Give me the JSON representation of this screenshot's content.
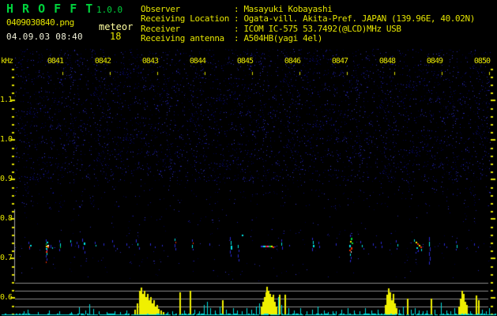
{
  "app": {
    "title": "H R O F F T",
    "version": "1.0.0"
  },
  "session": {
    "filename": "0409030840.png",
    "mode": "meteor",
    "datetime": "04.09.03 08:40",
    "echo_count": "18"
  },
  "station": {
    "rows": [
      {
        "label": "Observer",
        "value": "Masayuki Kobayashi"
      },
      {
        "label": "Receiving Location",
        "value": "Ogata-vill. Akita-Pref. JAPAN (139.96E, 40.02N)"
      },
      {
        "label": "Receiver",
        "value": "ICOM IC-575 53.7492(@LCD)MHz USB"
      },
      {
        "label": "Receiving antenna",
        "value": "A504HB(yagi 4el)"
      }
    ]
  },
  "colors": {
    "accent_green": "#00d23c",
    "accent_yellow": "#e3e300",
    "pale_yellow": "#ffffa0",
    "white_text": "#f0f0d8",
    "grid_gray": "#8a8a8a",
    "scale_bar_gray": "#a0a0a0",
    "trace_cyan": "#00e0e0",
    "trace_yellow": "#f0f000",
    "noise_blues": [
      "#00003e",
      "#000060",
      "#0e0e7a",
      "#1a1a92",
      "#2626ae",
      "#3434c8"
    ],
    "echo_palette": {
      "b": "#2a2ad2",
      "c": "#00e8e8",
      "g": "#00d838",
      "r": "#f03000",
      "m": "#e030d0",
      "y": "#f0f000",
      "w": "#f8f8f8"
    }
  },
  "chart_data": {
    "type": "heatmap",
    "ylabel": "kHz",
    "x_tick_labels": [
      "0841",
      "0842",
      "0843",
      "0844",
      "0845",
      "0846",
      "0847",
      "0848",
      "0849",
      "0850"
    ],
    "y_tick_labels": [
      "1.1",
      "1.0",
      "0.9",
      "0.8",
      "0.7",
      "0.6"
    ],
    "y_range_khz": [
      0.56,
      1.18
    ],
    "x_range_minutes": [
      0,
      10
    ],
    "echo_band_khz": 0.73,
    "echoes": [
      [
        0.28,
        0.742,
        1,
        3,
        "b"
      ],
      [
        0.32,
        0.734,
        2,
        2,
        "c"
      ],
      [
        0.3,
        0.73,
        1,
        2,
        "r"
      ],
      [
        0.3,
        0.726,
        1,
        2,
        "b"
      ],
      [
        0.65,
        0.748,
        1,
        3,
        "b"
      ],
      [
        0.67,
        0.742,
        2,
        2,
        "c"
      ],
      [
        0.65,
        0.738,
        1,
        2,
        "g"
      ],
      [
        0.68,
        0.734,
        2,
        2,
        "w"
      ],
      [
        0.65,
        0.732,
        2,
        2,
        "y"
      ],
      [
        0.68,
        0.73,
        2,
        2,
        "r"
      ],
      [
        0.65,
        0.726,
        2,
        2,
        "c"
      ],
      [
        0.67,
        0.722,
        1,
        2,
        "m"
      ],
      [
        0.65,
        0.718,
        2,
        2,
        "r"
      ],
      [
        0.67,
        0.714,
        1,
        3,
        "c"
      ],
      [
        0.65,
        0.708,
        1,
        3,
        "b"
      ],
      [
        0.67,
        0.7,
        1,
        3,
        "b"
      ],
      [
        0.65,
        0.692,
        1,
        2,
        "r"
      ],
      [
        0.75,
        0.734,
        1,
        4,
        "b"
      ],
      [
        0.78,
        0.728,
        1,
        2,
        "c"
      ],
      [
        0.93,
        0.746,
        1,
        3,
        "b"
      ],
      [
        0.95,
        0.738,
        1,
        4,
        "c"
      ],
      [
        0.95,
        0.73,
        1,
        2,
        "g"
      ],
      [
        0.93,
        0.724,
        1,
        3,
        "b"
      ],
      [
        1.17,
        0.746,
        1,
        3,
        "c"
      ],
      [
        1.18,
        0.738,
        1,
        4,
        "b"
      ],
      [
        1.3,
        0.742,
        1,
        3,
        "b"
      ],
      [
        1.33,
        0.734,
        1,
        4,
        "b"
      ],
      [
        1.42,
        0.75,
        1,
        4,
        "b"
      ],
      [
        1.45,
        0.74,
        2,
        3,
        "c"
      ],
      [
        1.43,
        0.73,
        1,
        4,
        "b"
      ],
      [
        1.47,
        0.718,
        1,
        3,
        "b"
      ],
      [
        1.68,
        0.742,
        1,
        3,
        "b"
      ],
      [
        1.7,
        0.734,
        1,
        2,
        "c"
      ],
      [
        1.87,
        0.738,
        1,
        3,
        "b"
      ],
      [
        2.05,
        0.746,
        1,
        3,
        "b"
      ],
      [
        2.08,
        0.734,
        1,
        3,
        "b"
      ],
      [
        2.15,
        0.726,
        1,
        2,
        "b"
      ],
      [
        2.35,
        0.738,
        1,
        3,
        "b"
      ],
      [
        2.4,
        0.73,
        1,
        2,
        "b"
      ],
      [
        2.55,
        0.748,
        1,
        4,
        "b"
      ],
      [
        2.58,
        0.738,
        1,
        3,
        "c"
      ],
      [
        2.62,
        0.728,
        1,
        3,
        "b"
      ],
      [
        2.85,
        0.738,
        1,
        3,
        "b"
      ],
      [
        2.95,
        0.73,
        1,
        2,
        "b"
      ],
      [
        3.1,
        0.734,
        1,
        2,
        "b"
      ],
      [
        3.37,
        0.75,
        1,
        3,
        "c"
      ],
      [
        3.38,
        0.742,
        1,
        2,
        "r"
      ],
      [
        3.37,
        0.736,
        1,
        4,
        "b"
      ],
      [
        3.38,
        0.726,
        1,
        3,
        "b"
      ],
      [
        3.73,
        0.748,
        1,
        3,
        "b"
      ],
      [
        3.75,
        0.74,
        1,
        2,
        "r"
      ],
      [
        3.73,
        0.734,
        1,
        4,
        "c"
      ],
      [
        3.75,
        0.724,
        1,
        2,
        "b"
      ],
      [
        4.1,
        0.738,
        1,
        3,
        "b"
      ],
      [
        4.53,
        0.754,
        1,
        4,
        "b"
      ],
      [
        4.55,
        0.744,
        1,
        5,
        "c"
      ],
      [
        4.55,
        0.732,
        2,
        5,
        "c"
      ],
      [
        4.53,
        0.72,
        1,
        4,
        "b"
      ],
      [
        4.55,
        0.71,
        1,
        3,
        "b"
      ],
      [
        4.7,
        0.734,
        1,
        4,
        "c"
      ],
      [
        4.72,
        0.722,
        1,
        3,
        "b"
      ],
      [
        4.7,
        0.71,
        1,
        4,
        "b"
      ],
      [
        4.72,
        0.698,
        1,
        3,
        "b"
      ],
      [
        4.78,
        0.76,
        2,
        2,
        "c"
      ],
      [
        5.18,
        0.732,
        3,
        2,
        "b"
      ],
      [
        5.23,
        0.732,
        3,
        2,
        "c"
      ],
      [
        5.28,
        0.732,
        2,
        2,
        "r"
      ],
      [
        5.32,
        0.732,
        2,
        2,
        "m"
      ],
      [
        5.35,
        0.732,
        3,
        2,
        "g"
      ],
      [
        5.4,
        0.732,
        2,
        2,
        "y"
      ],
      [
        5.43,
        0.73,
        2,
        2,
        "r"
      ],
      [
        5.47,
        0.73,
        2,
        1,
        "b"
      ],
      [
        5.62,
        0.748,
        1,
        3,
        "b"
      ],
      [
        5.62,
        0.74,
        1,
        4,
        "c"
      ],
      [
        5.63,
        0.73,
        1,
        4,
        "b"
      ],
      [
        5.78,
        0.734,
        1,
        2,
        "b"
      ],
      [
        6.27,
        0.752,
        1,
        3,
        "b"
      ],
      [
        6.28,
        0.744,
        1,
        4,
        "c"
      ],
      [
        6.28,
        0.734,
        2,
        3,
        "c"
      ],
      [
        6.27,
        0.726,
        1,
        4,
        "b"
      ],
      [
        6.4,
        0.742,
        1,
        3,
        "b"
      ],
      [
        6.42,
        0.732,
        1,
        3,
        "b"
      ],
      [
        6.77,
        0.738,
        1,
        3,
        "b"
      ],
      [
        7.07,
        0.76,
        1,
        3,
        "b"
      ],
      [
        7.08,
        0.752,
        2,
        3,
        "g"
      ],
      [
        7.07,
        0.744,
        2,
        2,
        "y"
      ],
      [
        7.1,
        0.74,
        2,
        2,
        "g"
      ],
      [
        7.05,
        0.734,
        2,
        3,
        "c"
      ],
      [
        7.08,
        0.728,
        2,
        3,
        "r"
      ],
      [
        7.05,
        0.722,
        2,
        2,
        "r"
      ],
      [
        7.08,
        0.718,
        1,
        2,
        "w"
      ],
      [
        7.07,
        0.712,
        1,
        3,
        "c"
      ],
      [
        7.08,
        0.704,
        1,
        3,
        "b"
      ],
      [
        7.07,
        0.696,
        1,
        3,
        "b"
      ],
      [
        7.28,
        0.744,
        1,
        3,
        "b"
      ],
      [
        7.32,
        0.734,
        1,
        3,
        "c"
      ],
      [
        7.35,
        0.726,
        1,
        2,
        "b"
      ],
      [
        7.55,
        0.738,
        1,
        3,
        "b"
      ],
      [
        7.6,
        0.73,
        1,
        2,
        "b"
      ],
      [
        7.72,
        0.742,
        1,
        3,
        "b"
      ],
      [
        7.73,
        0.732,
        1,
        3,
        "b"
      ],
      [
        8.03,
        0.746,
        1,
        3,
        "b"
      ],
      [
        8.07,
        0.736,
        1,
        3,
        "c"
      ],
      [
        8.05,
        0.726,
        1,
        2,
        "b"
      ],
      [
        8.42,
        0.748,
        1,
        3,
        "c"
      ],
      [
        8.45,
        0.742,
        2,
        2,
        "y"
      ],
      [
        8.48,
        0.738,
        2,
        2,
        "r"
      ],
      [
        8.52,
        0.734,
        2,
        2,
        "y"
      ],
      [
        8.55,
        0.73,
        2,
        2,
        "r"
      ],
      [
        8.47,
        0.728,
        2,
        2,
        "c"
      ],
      [
        8.5,
        0.722,
        1,
        3,
        "b"
      ],
      [
        8.57,
        0.724,
        1,
        3,
        "c"
      ],
      [
        8.45,
        0.716,
        1,
        2,
        "b"
      ],
      [
        8.73,
        0.754,
        1,
        5,
        "b"
      ],
      [
        8.73,
        0.742,
        1,
        6,
        "c"
      ],
      [
        8.75,
        0.728,
        1,
        5,
        "b"
      ],
      [
        8.73,
        0.716,
        1,
        5,
        "b"
      ],
      [
        8.75,
        0.704,
        1,
        5,
        "b"
      ],
      [
        8.73,
        0.692,
        1,
        4,
        "b"
      ],
      [
        9.05,
        0.738,
        1,
        3,
        "b"
      ],
      [
        9.1,
        0.73,
        1,
        2,
        "b"
      ],
      [
        9.3,
        0.744,
        1,
        3,
        "b"
      ],
      [
        9.32,
        0.734,
        1,
        4,
        "c"
      ],
      [
        9.3,
        0.724,
        1,
        2,
        "b"
      ],
      [
        9.68,
        0.738,
        1,
        3,
        "b"
      ],
      [
        9.77,
        0.73,
        1,
        2,
        "b"
      ]
    ],
    "power_panel": {
      "gridlines": 4,
      "spikes": [
        [
          0.18,
          4,
          "c"
        ],
        [
          0.27,
          6,
          "c"
        ],
        [
          0.48,
          3,
          "c"
        ],
        [
          0.72,
          5,
          "c"
        ],
        [
          0.93,
          4,
          "c"
        ],
        [
          1.18,
          3,
          "c"
        ],
        [
          1.35,
          9,
          "c"
        ],
        [
          1.48,
          5,
          "c"
        ],
        [
          1.57,
          13,
          "c"
        ],
        [
          1.65,
          7,
          "c"
        ],
        [
          1.77,
          4,
          "c"
        ],
        [
          1.93,
          3,
          "c"
        ],
        [
          2.1,
          4,
          "c"
        ],
        [
          2.22,
          3,
          "c"
        ],
        [
          2.35,
          5,
          "c"
        ],
        [
          2.52,
          6,
          "y"
        ],
        [
          2.57,
          14,
          "y"
        ],
        [
          2.62,
          30,
          "y"
        ],
        [
          2.65,
          34,
          "y"
        ],
        [
          2.68,
          26,
          "y"
        ],
        [
          2.72,
          30,
          "y"
        ],
        [
          2.75,
          22,
          "y"
        ],
        [
          2.78,
          26,
          "y"
        ],
        [
          2.82,
          18,
          "y"
        ],
        [
          2.85,
          22,
          "y"
        ],
        [
          2.88,
          14,
          "y"
        ],
        [
          2.92,
          18,
          "y"
        ],
        [
          2.95,
          10,
          "y"
        ],
        [
          2.98,
          12,
          "y"
        ],
        [
          3.02,
          7,
          "y"
        ],
        [
          3.07,
          5,
          "y"
        ],
        [
          3.12,
          3,
          "y"
        ],
        [
          3.22,
          3,
          "c"
        ],
        [
          3.32,
          4,
          "c"
        ],
        [
          3.47,
          28,
          "y"
        ],
        [
          3.57,
          5,
          "c"
        ],
        [
          3.68,
          30,
          "y"
        ],
        [
          3.78,
          6,
          "c"
        ],
        [
          3.88,
          4,
          "c"
        ],
        [
          3.98,
          12,
          "c"
        ],
        [
          4.05,
          16,
          "c"
        ],
        [
          4.12,
          8,
          "c"
        ],
        [
          4.22,
          5,
          "c"
        ],
        [
          4.32,
          10,
          "c"
        ],
        [
          4.37,
          18,
          "y"
        ],
        [
          4.45,
          6,
          "c"
        ],
        [
          4.6,
          8,
          "c"
        ],
        [
          4.68,
          5,
          "c"
        ],
        [
          4.78,
          4,
          "c"
        ],
        [
          4.88,
          8,
          "c"
        ],
        [
          4.98,
          6,
          "c"
        ],
        [
          5.08,
          10,
          "c"
        ],
        [
          5.15,
          14,
          "c"
        ],
        [
          5.18,
          10,
          "y"
        ],
        [
          5.22,
          16,
          "y"
        ],
        [
          5.25,
          22,
          "y"
        ],
        [
          5.28,
          28,
          "y"
        ],
        [
          5.3,
          35,
          "y"
        ],
        [
          5.33,
          30,
          "y"
        ],
        [
          5.37,
          26,
          "y"
        ],
        [
          5.4,
          22,
          "y"
        ],
        [
          5.43,
          25,
          "y"
        ],
        [
          5.47,
          16,
          "y"
        ],
        [
          5.5,
          10,
          "y"
        ],
        [
          5.55,
          22,
          "c"
        ],
        [
          5.57,
          25,
          "y"
        ],
        [
          5.62,
          12,
          "c"
        ],
        [
          5.68,
          25,
          "y"
        ],
        [
          5.77,
          8,
          "c"
        ],
        [
          5.88,
          5,
          "c"
        ],
        [
          6.02,
          8,
          "c"
        ],
        [
          6.15,
          4,
          "c"
        ],
        [
          6.27,
          6,
          "c"
        ],
        [
          6.38,
          10,
          "c"
        ],
        [
          6.52,
          5,
          "c"
        ],
        [
          6.6,
          3,
          "c"
        ],
        [
          6.7,
          4,
          "c"
        ],
        [
          6.77,
          4,
          "c"
        ],
        [
          6.88,
          6,
          "c"
        ],
        [
          7.02,
          8,
          "c"
        ],
        [
          7.15,
          5,
          "c"
        ],
        [
          7.27,
          4,
          "c"
        ],
        [
          7.38,
          8,
          "c"
        ],
        [
          7.52,
          5,
          "c"
        ],
        [
          7.65,
          6,
          "c"
        ],
        [
          7.8,
          12,
          "y"
        ],
        [
          7.83,
          25,
          "y"
        ],
        [
          7.87,
          33,
          "y"
        ],
        [
          7.9,
          28,
          "y"
        ],
        [
          7.93,
          18,
          "y"
        ],
        [
          7.97,
          26,
          "y"
        ],
        [
          8.0,
          14,
          "y"
        ],
        [
          8.03,
          8,
          "y"
        ],
        [
          8.1,
          6,
          "c"
        ],
        [
          8.18,
          10,
          "c"
        ],
        [
          8.27,
          20,
          "y"
        ],
        [
          8.35,
          6,
          "c"
        ],
        [
          8.43,
          8,
          "c"
        ],
        [
          8.52,
          5,
          "c"
        ],
        [
          8.6,
          4,
          "c"
        ],
        [
          8.68,
          5,
          "c"
        ],
        [
          8.77,
          20,
          "y"
        ],
        [
          8.85,
          6,
          "c"
        ],
        [
          8.98,
          15,
          "c"
        ],
        [
          9.1,
          5,
          "c"
        ],
        [
          9.18,
          4,
          "c"
        ],
        [
          9.27,
          8,
          "c"
        ],
        [
          9.35,
          10,
          "y"
        ],
        [
          9.38,
          20,
          "y"
        ],
        [
          9.42,
          30,
          "y"
        ],
        [
          9.45,
          26,
          "y"
        ],
        [
          9.48,
          16,
          "y"
        ],
        [
          9.52,
          12,
          "y"
        ],
        [
          9.6,
          4,
          "c"
        ],
        [
          9.72,
          24,
          "y"
        ],
        [
          9.77,
          18,
          "y"
        ],
        [
          9.85,
          6,
          "c"
        ],
        [
          9.93,
          4,
          "c"
        ],
        [
          10.0,
          8,
          "c"
        ]
      ]
    }
  }
}
